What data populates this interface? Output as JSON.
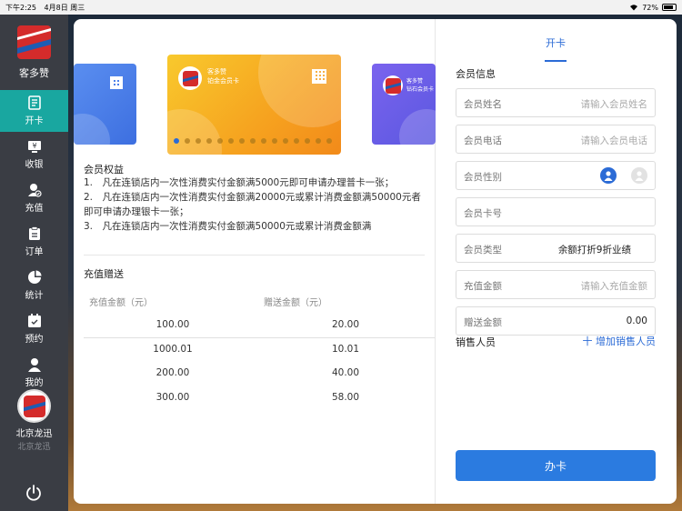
{
  "status_bar": {
    "time": "下午2:25",
    "date": "4月8日 周三",
    "battery": "72%"
  },
  "app": {
    "name": "客多赞"
  },
  "sidebar": {
    "items": [
      {
        "label": "开卡",
        "icon": "card-icon",
        "active": true
      },
      {
        "label": "收银",
        "icon": "cashier-icon",
        "active": false
      },
      {
        "label": "充值",
        "icon": "recharge-icon",
        "active": false
      },
      {
        "label": "订单",
        "icon": "order-icon",
        "active": false
      },
      {
        "label": "统计",
        "icon": "stats-icon",
        "active": false
      },
      {
        "label": "预约",
        "icon": "calendar-icon",
        "active": false
      },
      {
        "label": "我的",
        "icon": "user-icon",
        "active": false
      }
    ],
    "store_name": "北京龙迅",
    "store_sub": "北京龙迅"
  },
  "cards": {
    "center": {
      "brand": "客多赞",
      "level": "铂金会员卡"
    },
    "right": {
      "brand": "客多赞",
      "level": "钻石会员卡"
    },
    "dot_count": 15,
    "active_dot": 0
  },
  "benefits": {
    "title": "会员权益",
    "lines": [
      "1.　凡在连锁店内一次性消费实付金额满5000元即可申请办理普卡一张；",
      "2.　凡在连锁店内一次性消费实付金额满20000元或累计消费金额满50000元者即可申请办理银卡一张；",
      "3.　凡在连锁店内一次性消费实付金额满50000元或累计消费金额满"
    ]
  },
  "recharge": {
    "title": "充值赠送",
    "col_amount": "充值金额（元）",
    "col_bonus": "赠送金额（元）",
    "rows": [
      {
        "amount": "100.00",
        "bonus": "20.00"
      },
      {
        "amount": "1000.01",
        "bonus": "10.01"
      },
      {
        "amount": "200.00",
        "bonus": "40.00"
      },
      {
        "amount": "300.00",
        "bonus": "58.00"
      }
    ]
  },
  "form": {
    "tab": "开卡",
    "section_title": "会员信息",
    "name": {
      "label": "会员姓名",
      "placeholder": "请输入会员姓名"
    },
    "phone": {
      "label": "会员电话",
      "placeholder": "请输入会员电话"
    },
    "gender": {
      "label": "会员性别"
    },
    "card_no": {
      "label": "会员卡号"
    },
    "type": {
      "label": "会员类型",
      "value": "余额打折9折业绩"
    },
    "recharge_amount": {
      "label": "充值金额",
      "placeholder": "请输入充值金额"
    },
    "bonus_amount": {
      "label": "赠送金额",
      "value": "0.00"
    },
    "sales_label": "销售人员",
    "sales_add": "十 增加销售人员",
    "submit": "办卡"
  },
  "colors": {
    "accent": "#2b7be0",
    "sidebar_active": "#19a7a0",
    "sidebar_bg": "#3a3d44"
  }
}
